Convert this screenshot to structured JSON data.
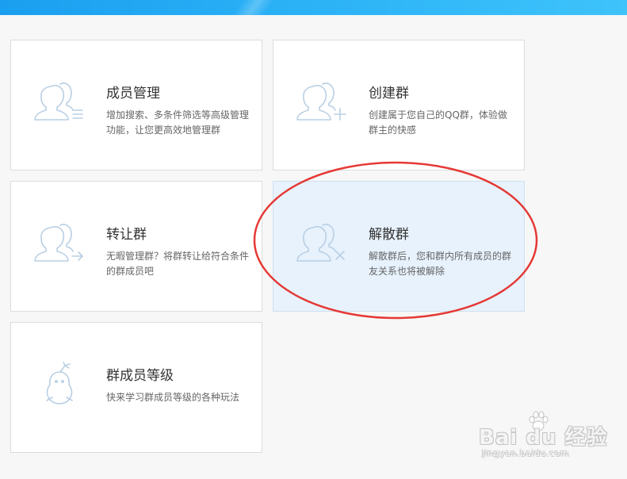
{
  "cards": [
    {
      "title": "成员管理",
      "desc": "增加搜索、多条件筛选等高级管理功能，让您更高效地管理群",
      "icon": "members-list-icon"
    },
    {
      "title": "创建群",
      "desc": "创建属于您自己的QQ群，体验做群主的快感",
      "icon": "members-add-icon"
    },
    {
      "title": "转让群",
      "desc": "无暇管理群？将群转让给符合条件的群成员吧",
      "icon": "members-transfer-icon"
    },
    {
      "title": "解散群",
      "desc": "解散群后，您和群内所有成员的群友关系也将被解除",
      "icon": "members-dismiss-icon"
    },
    {
      "title": "群成员等级",
      "desc": "快来学习群成员等级的各种玩法",
      "icon": "penguin-icon"
    }
  ],
  "annotation": {
    "color": "#e53935"
  },
  "watermark": {
    "brand": "Bai  du 经验",
    "url": "jingyan.baidu.com"
  },
  "colors": {
    "topbar": "#2fb6f7",
    "icon": "#b9cfe4",
    "selected_bg": "#e7f2fd"
  }
}
